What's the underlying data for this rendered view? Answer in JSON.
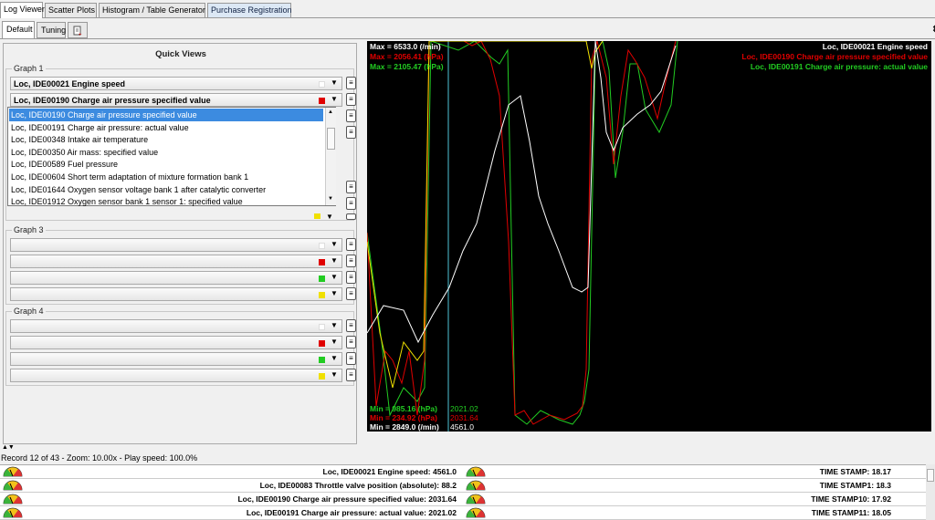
{
  "tabs": [
    "Log Viewer",
    "Scatter Plots",
    "Histogram / Table Generator",
    "Purchase Registration"
  ],
  "subtabs": [
    "Default",
    "Tuning"
  ],
  "quick_views_title": "Quick Views",
  "graph1": {
    "label": "Graph 1",
    "combos": [
      "Loc, IDE00021 Engine speed",
      "Loc, IDE00190 Charge air pressure specified value"
    ]
  },
  "dropdown_items": [
    "Loc, IDE00190 Charge air pressure specified value",
    "Loc, IDE00191 Charge air pressure: actual value",
    "Loc, IDE00348 Intake air temperature",
    "Loc, IDE00350 Air mass: specified value",
    "Loc, IDE00589 Fuel pressure",
    "Loc, IDE00604 Short term adaptation of mixture formation bank 1",
    "Loc, IDE01644 Oxygen sensor voltage bank 1 after catalytic converter",
    "Loc, IDE01912 Oxygen sensor bank 1 sensor 1: specified value"
  ],
  "graph3": {
    "label": "Graph 3"
  },
  "graph4": {
    "label": "Graph 4"
  },
  "colors": {
    "white": "#ffffff",
    "red": "#e00000",
    "green": "#22cc22",
    "yellow": "#f0e000"
  },
  "chart": {
    "max_labels": [
      "Max = 6533.0 (/min)",
      "Max = 2056.41 (hPa)",
      "Max = 2105.47 (hPa)"
    ],
    "min_labels": [
      "Min = 985.16 (hPa)",
      "Min = 234.92 (hPa)",
      "Min = 2849.0 (/min)"
    ],
    "cursor_values": [
      "2021.02",
      "2031.64",
      "4561.0"
    ],
    "legend": [
      "Loc, IDE00021 Engine speed",
      "Loc, IDE00190 Charge air pressure specified value",
      "Loc, IDE00191 Charge air pressure: actual value"
    ]
  },
  "status": "Record 12 of 43 - Zoom: 10.00x - Play speed: 100.0%",
  "rows_left": [
    "Loc, IDE00021 Engine speed: 4561.0",
    "Loc, IDE00083 Throttle valve position (absolute): 88.2",
    "Loc, IDE00190 Charge air pressure specified value: 2031.64",
    "Loc, IDE00191 Charge air pressure: actual value: 2021.02"
  ],
  "rows_right": [
    "TIME STAMP: 18.17",
    "TIME STAMP1: 18.3",
    "TIME STAMP10: 17.92",
    "TIME STAMP11: 18.05"
  ]
}
